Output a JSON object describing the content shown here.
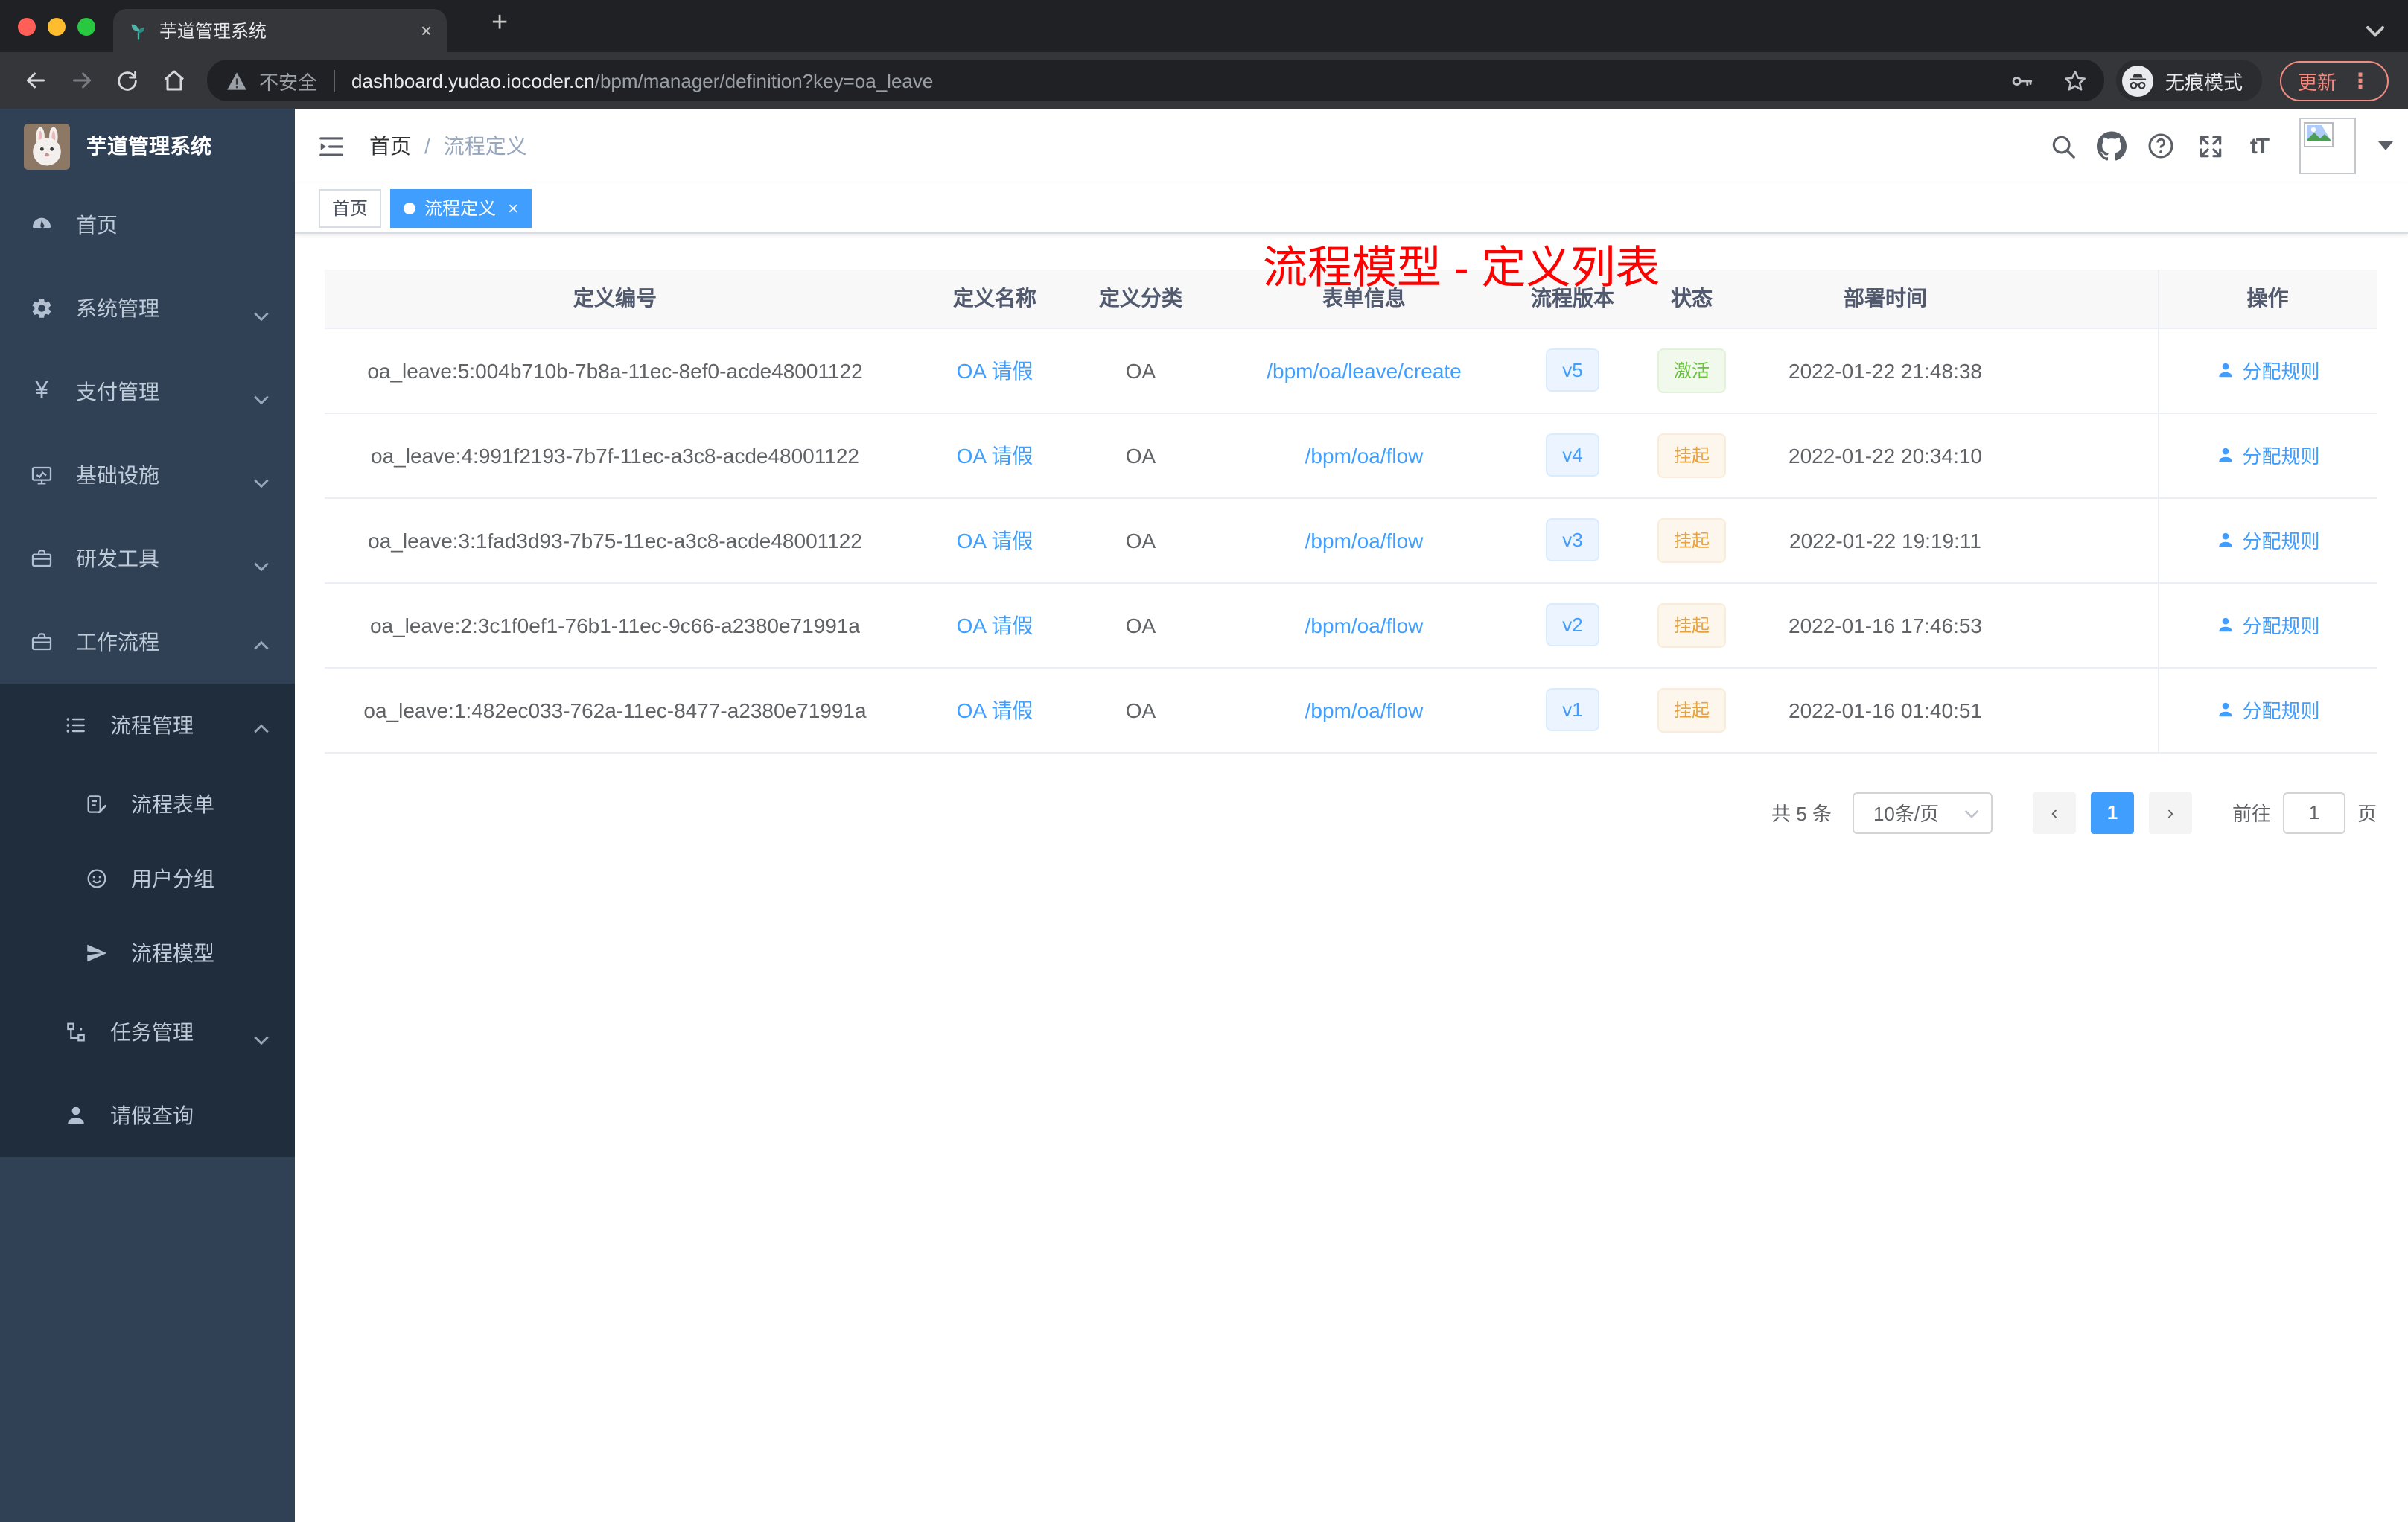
{
  "browser": {
    "tab_title": "芋道管理系统",
    "tab_close": "×",
    "new_tab": "+",
    "security_label": "不安全",
    "url_domain": "dashboard.yudao.iocoder.cn",
    "url_path": "/bpm/manager/definition?key=oa_leave",
    "incognito_label": "无痕模式",
    "update_label": "更新",
    "menu_dots": "⋮",
    "traffic_colors": {
      "close": "#ff5f57",
      "min": "#febc2e",
      "max": "#28c840"
    }
  },
  "sidebar": {
    "logo_title": "芋道管理系统",
    "items": [
      {
        "label": "首页"
      },
      {
        "label": "系统管理"
      },
      {
        "label": "支付管理"
      },
      {
        "label": "基础设施"
      },
      {
        "label": "研发工具"
      },
      {
        "label": "工作流程"
      },
      {
        "label": "流程管理"
      },
      {
        "label": "流程表单"
      },
      {
        "label": "用户分组"
      },
      {
        "label": "流程模型"
      },
      {
        "label": "任务管理"
      },
      {
        "label": "请假查询"
      }
    ]
  },
  "header": {
    "breadcrumb": [
      "首页",
      "流程定义"
    ],
    "breadcrumb_separator": "/",
    "text_size_label": "tT"
  },
  "annotation": "流程模型 - 定义列表",
  "tags": {
    "home": "首页",
    "active": "流程定义",
    "active_close": "×"
  },
  "table": {
    "headers": {
      "id": "定义编号",
      "name": "定义名称",
      "category": "定义分类",
      "form": "表单信息",
      "version": "流程版本",
      "status": "状态",
      "deploy_time": "部署时间",
      "action": "操作"
    },
    "rows": [
      {
        "id": "oa_leave:5:004b710b-7b8a-11ec-8ef0-acde48001122",
        "name": "OA 请假",
        "category": "OA",
        "form": "/bpm/oa/leave/create",
        "version": "v5",
        "status": "激活",
        "status_type": "success",
        "deploy_time": "2022-01-22 21:48:38",
        "action": "分配规则"
      },
      {
        "id": "oa_leave:4:991f2193-7b7f-11ec-a3c8-acde48001122",
        "name": "OA 请假",
        "category": "OA",
        "form": "/bpm/oa/flow",
        "version": "v4",
        "status": "挂起",
        "status_type": "warning",
        "deploy_time": "2022-01-22 20:34:10",
        "action": "分配规则"
      },
      {
        "id": "oa_leave:3:1fad3d93-7b75-11ec-a3c8-acde48001122",
        "name": "OA 请假",
        "category": "OA",
        "form": "/bpm/oa/flow",
        "version": "v3",
        "status": "挂起",
        "status_type": "warning",
        "deploy_time": "2022-01-22 19:19:11",
        "action": "分配规则"
      },
      {
        "id": "oa_leave:2:3c1f0ef1-76b1-11ec-9c66-a2380e71991a",
        "name": "OA 请假",
        "category": "OA",
        "form": "/bpm/oa/flow",
        "version": "v2",
        "status": "挂起",
        "status_type": "warning",
        "deploy_time": "2022-01-16 17:46:53",
        "action": "分配规则"
      },
      {
        "id": "oa_leave:1:482ec033-762a-11ec-8477-a2380e71991a",
        "name": "OA 请假",
        "category": "OA",
        "form": "/bpm/oa/flow",
        "version": "v1",
        "status": "挂起",
        "status_type": "warning",
        "deploy_time": "2022-01-16 01:40:51",
        "action": "分配规则"
      }
    ]
  },
  "pagination": {
    "total": "共 5 条",
    "page_size": "10条/页",
    "prev": "‹",
    "page": "1",
    "next": "›",
    "goto_prefix": "前往",
    "goto_value": "1",
    "goto_suffix": "页"
  },
  "colors": {
    "accent": "#409eff",
    "success": "#67c23a",
    "warning": "#e6a23c",
    "annotation_red": "#ff0000",
    "sidebar_bg": "#304156",
    "submenu_bg": "#1f2d3d"
  }
}
